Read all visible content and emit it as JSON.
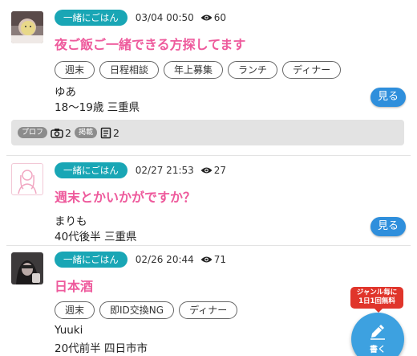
{
  "posts": [
    {
      "genre": "一緒にごはん",
      "date": "03/04 00:50",
      "views": "60",
      "title": "夜ご飯ご一緒できる方探してます",
      "tags": [
        "週末",
        "日程相談",
        "年上募集",
        "ランチ",
        "ディナー"
      ],
      "user_name": "ゆあ",
      "user_info": "18〜19歳 三重県",
      "see_label": "見る",
      "profile": {
        "badge_profile": "プロフ",
        "photo_count": "2",
        "badge_posted": "掲載",
        "post_count": "2"
      }
    },
    {
      "genre": "一緒にごはん",
      "date": "02/27 21:53",
      "views": "27",
      "title": "週末とかいかがですか？",
      "tags": [],
      "user_name": "まりも",
      "user_info": "40代後半 三重県",
      "see_label": "見る"
    },
    {
      "genre": "一緒にごはん",
      "date": "02/26 20:44",
      "views": "71",
      "title": "日本酒",
      "tags": [
        "週末",
        "即ID交換NG",
        "ディナー"
      ],
      "user_name": "Yuuki",
      "user_info": "20代前半 四日市市"
    }
  ],
  "fab": {
    "note_line1": "ジャンル毎に",
    "note_line2": "1日1回無料",
    "label": "書く",
    "icon": "pencil-icon"
  },
  "colors": {
    "genre": "#19a6b5",
    "title": "#ee5a9c",
    "button": "#2f8fdc",
    "fab": "#3da1e0",
    "note": "#e0352b"
  }
}
